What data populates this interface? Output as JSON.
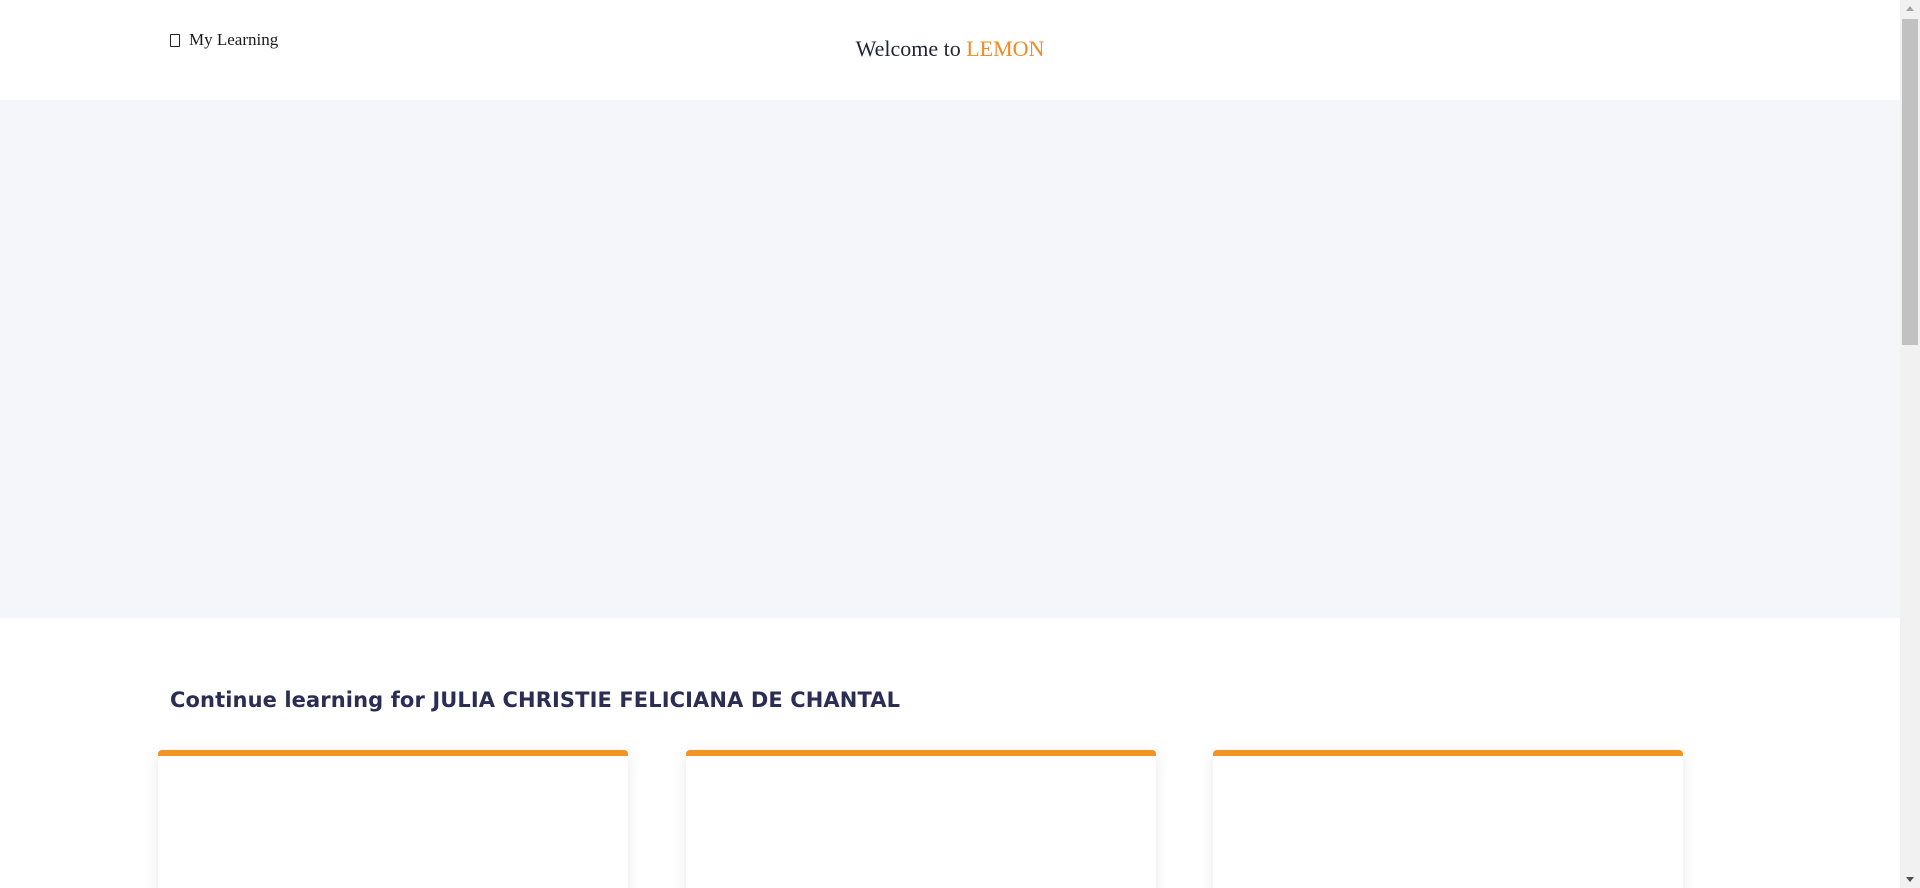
{
  "header": {
    "nav_link_label": "My Learning",
    "nav_link_icon": "book-icon",
    "welcome_prefix": "Welcome to ",
    "brand_name": "LEMON"
  },
  "colors": {
    "brand": "#f08a24",
    "card_accent": "#f39322",
    "heading": "#2b2d52",
    "hero_background": "#f5f6f9"
  },
  "continue_section": {
    "title": "Continue learning for JULIA CHRISTIE FELICIANA DE CHANTAL"
  }
}
